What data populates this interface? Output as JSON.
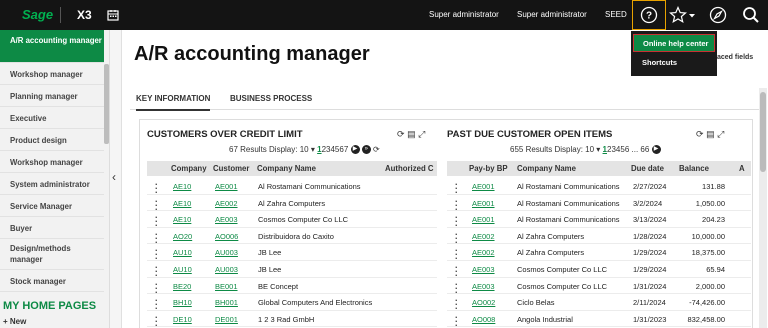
{
  "topbar": {
    "logo": "Sage",
    "product": "X3",
    "user1": "Super administrator",
    "user2": "Super administrator",
    "folder": "SEED",
    "icons": [
      "calendar-icon",
      "help-icon",
      "star-icon",
      "chevron-down-icon",
      "compass-icon",
      "search-icon"
    ]
  },
  "help_menu": {
    "online": "Online help center",
    "shortcuts": "Shortcuts"
  },
  "sidebar": {
    "items": [
      {
        "label": "A/R accounting manager",
        "active": true
      },
      {
        "label": "Workshop manager"
      },
      {
        "label": "Planning manager"
      },
      {
        "label": "Executive"
      },
      {
        "label": "Product design"
      },
      {
        "label": "Workshop manager"
      },
      {
        "label": "System administrator"
      },
      {
        "label": "Service Manager"
      },
      {
        "label": "Buyer"
      },
      {
        "label": "Design/methods manager"
      },
      {
        "label": "Stock manager"
      }
    ],
    "home_pages": "MY HOME PAGES",
    "new_label": "New",
    "new_icon": "plus-icon"
  },
  "main": {
    "title": "A/R accounting manager",
    "advanced_fields": "aced fields",
    "tabs": [
      "KEY INFORMATION",
      "BUSINESS PROCESS"
    ]
  },
  "panel_left": {
    "title": "CUSTOMERS OVER CREDIT LIMIT",
    "results_text": "67 Results  Display:",
    "display_value": "10",
    "pages": [
      "1",
      "2",
      "3",
      "4",
      "5",
      "6",
      "7"
    ],
    "columns": [
      "Company",
      "Customer",
      "Company Name",
      "Authorized C"
    ],
    "rows": [
      [
        "AE10",
        "AE001",
        "Al Rostamani Communications"
      ],
      [
        "AE10",
        "AE002",
        "Al Zahra Computers"
      ],
      [
        "AE10",
        "AE003",
        "Cosmos Computer Co LLC"
      ],
      [
        "AO20",
        "AO006",
        "Distribuidora do Caxito"
      ],
      [
        "AU10",
        "AU003",
        "JB Lee"
      ],
      [
        "AU10",
        "AU003",
        "JB Lee"
      ],
      [
        "BE20",
        "BE001",
        "BE Concept"
      ],
      [
        "BH10",
        "BH001",
        "Global Computers And Electronics"
      ],
      [
        "DE10",
        "DE001",
        "1 2 3 Rad GmbH"
      ]
    ]
  },
  "panel_right": {
    "title": "PAST DUE CUSTOMER OPEN ITEMS",
    "results_text": "655 Results  Display:",
    "display_value": "10",
    "pages": [
      "1",
      "2",
      "3",
      "4",
      "5",
      "6",
      "...",
      "66"
    ],
    "columns": [
      "Pay-by BP",
      "Company Name",
      "Due date",
      "Balance",
      "A"
    ],
    "rows": [
      [
        "AE001",
        "Al Rostamani Communications",
        "2/27/2024",
        "131.88"
      ],
      [
        "AE001",
        "Al Rostamani Communications",
        "3/2/2024",
        "1,050.00"
      ],
      [
        "AE001",
        "Al Rostamani Communications",
        "3/13/2024",
        "204.23"
      ],
      [
        "AE002",
        "Al Zahra Computers",
        "1/28/2024",
        "10,000.00"
      ],
      [
        "AE002",
        "Al Zahra Computers",
        "1/29/2024",
        "18,375.00"
      ],
      [
        "AE003",
        "Cosmos Computer Co LLC",
        "1/29/2024",
        "65.94"
      ],
      [
        "AE003",
        "Cosmos Computer Co LLC",
        "1/31/2024",
        "2,000.00"
      ],
      [
        "AO002",
        "Ciclo Belas",
        "2/11/2024",
        "-74,426.00"
      ],
      [
        "AO008",
        "Angola Industrial",
        "1/31/2023",
        "832,458.00"
      ]
    ]
  },
  "colors": {
    "accent": "#0d8a45",
    "topbar": "#141414",
    "highlight": "#e8a200",
    "menu_border": "#c83232"
  }
}
